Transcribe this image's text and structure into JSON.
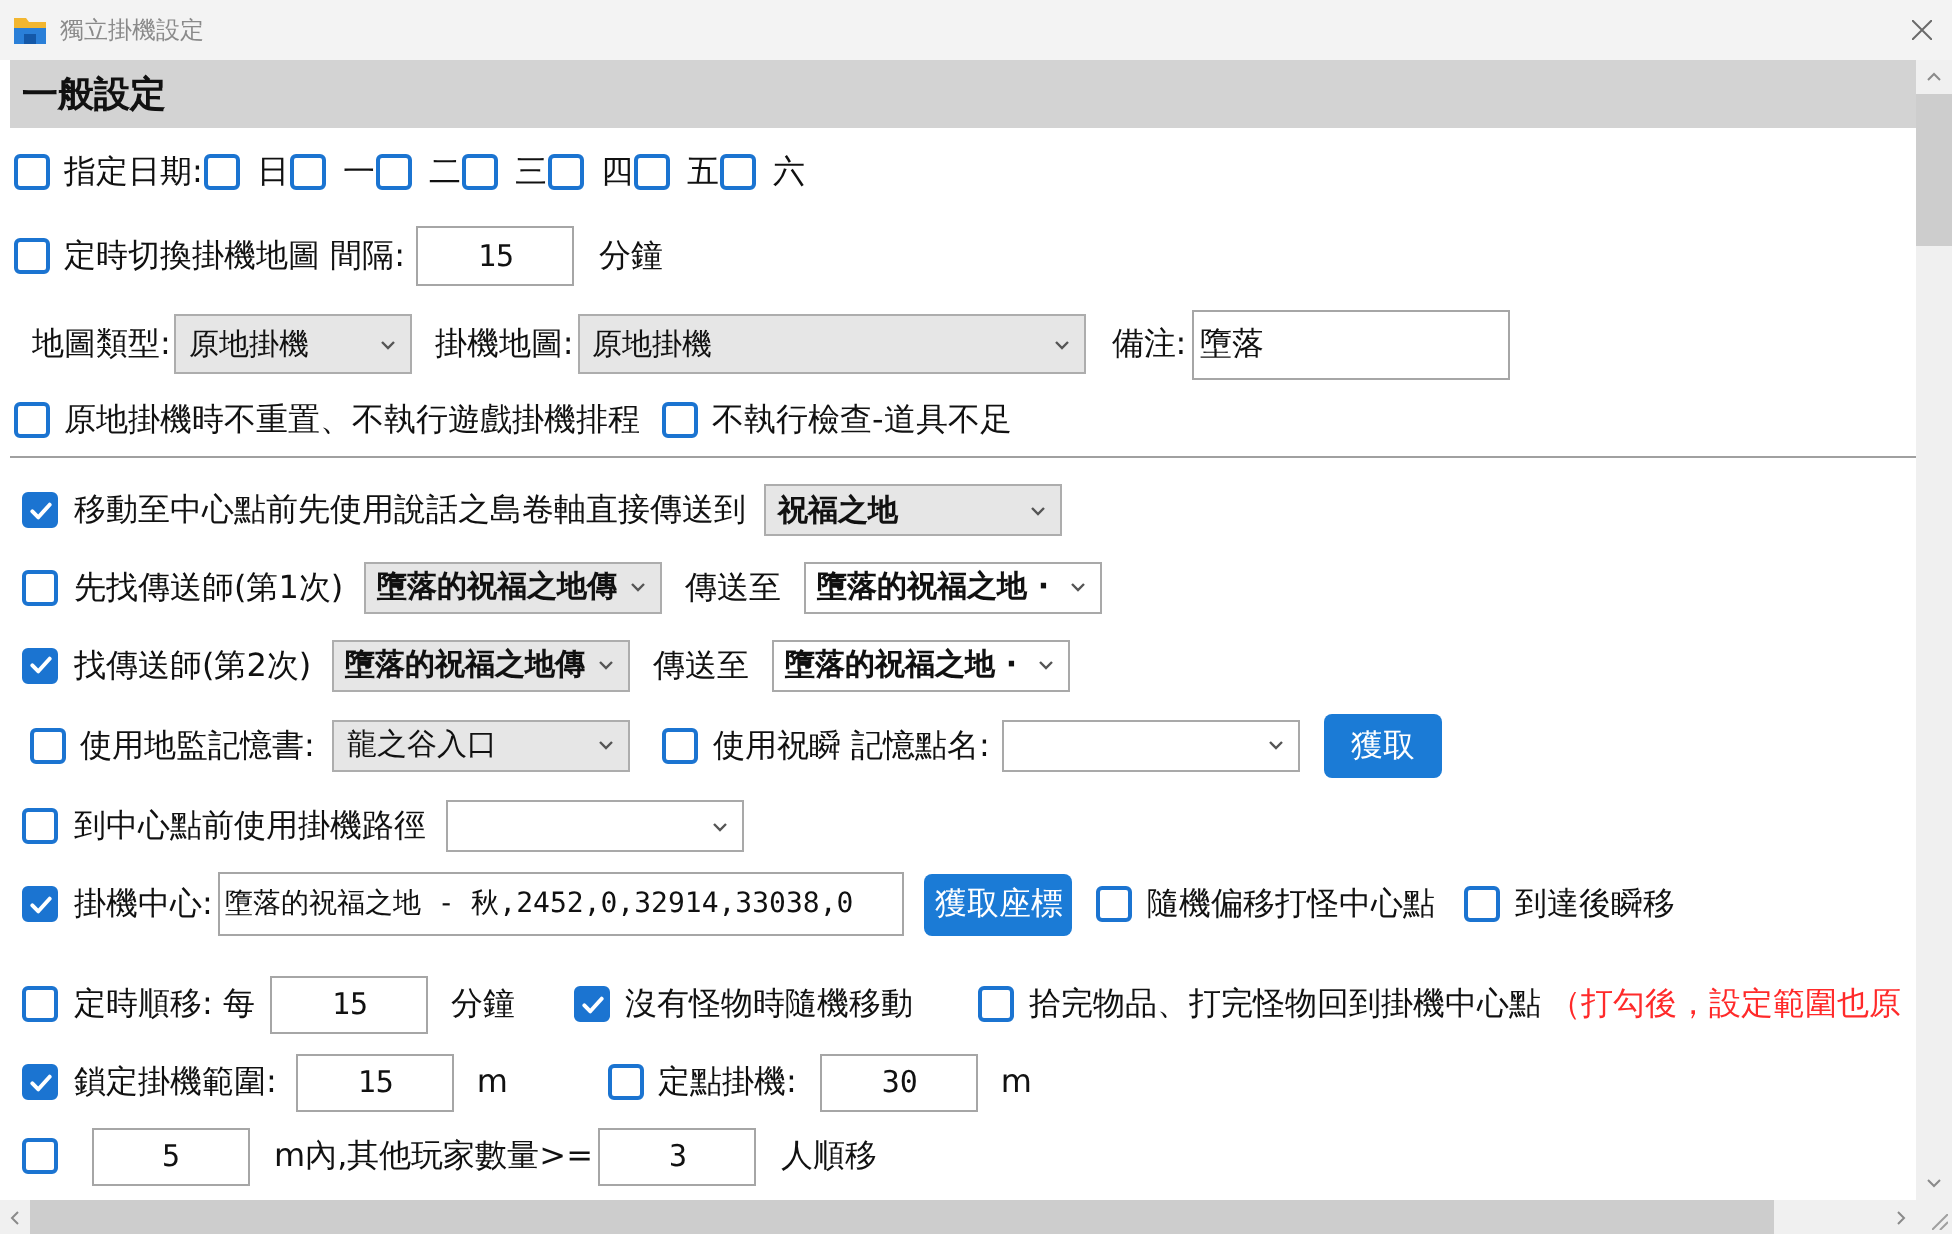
{
  "window": {
    "title": "獨立掛機設定"
  },
  "section": {
    "title": "一般設定"
  },
  "schedule": {
    "label": "指定日期:",
    "checked": false,
    "days": [
      {
        "label": "日",
        "checked": false
      },
      {
        "label": "一",
        "checked": false
      },
      {
        "label": "二",
        "checked": false
      },
      {
        "label": "三",
        "checked": false
      },
      {
        "label": "四",
        "checked": false
      },
      {
        "label": "五",
        "checked": false
      },
      {
        "label": "六",
        "checked": false
      }
    ]
  },
  "map_switch": {
    "label": "定時切換掛機地圖 間隔:",
    "checked": false,
    "value": "15",
    "unit": "分鐘"
  },
  "map_settings": {
    "map_type": {
      "label": "地圖類型:",
      "dropdown": {
        "value": "原地掛機",
        "editable": false
      }
    },
    "idle_map": {
      "label": "掛機地圖:",
      "dropdown": {
        "value": "原地掛機",
        "editable": false
      }
    },
    "note": {
      "label": "備注:",
      "value": "墮落"
    }
  },
  "idle_options": [
    {
      "label": "原地掛機時不重置、不執行遊戲掛機排程",
      "checked": false
    },
    {
      "label": "不執行檢查-道具不足",
      "checked": false
    }
  ],
  "scroll_teleport": {
    "label": "移動至中心點前先使用說話之島卷軸直接傳送到",
    "checked": true,
    "dropdown": {
      "value": "祝福之地",
      "editable": false
    }
  },
  "teleporters": [
    {
      "label": "先找傳送師(第1次)",
      "checked": false,
      "npc": {
        "value": "墮落的祝福之地傳",
        "editable": false
      },
      "to_label": "傳送至",
      "destination": {
        "value": "墮落的祝福之地 ·",
        "editable": true
      }
    },
    {
      "label": "找傳送師(第2次)",
      "checked": true,
      "npc": {
        "value": "墮落的祝福之地傳",
        "editable": false
      },
      "to_label": "傳送至",
      "destination": {
        "value": "墮落的祝福之地 ·",
        "editable": true
      }
    }
  ],
  "memory": {
    "book": {
      "label": "使用地監記憶書:",
      "checked": false,
      "dropdown": {
        "value": "龍之谷入口",
        "editable": false
      }
    },
    "blessed": {
      "label": "使用祝瞬 記憶點名:",
      "checked": false,
      "dropdown": {
        "editable": true
      }
    },
    "button": "獲取"
  },
  "route": {
    "label": "到中心點前使用掛機路徑",
    "checked": false,
    "dropdown": {
      "editable": true
    }
  },
  "center": {
    "label": "掛機中心:",
    "checked": true,
    "value": "墮落的祝福之地 - 秋,2452,0,32914,33038,0",
    "button": "獲取座標",
    "options": [
      {
        "label": "隨機偏移打怪中心點",
        "checked": false
      },
      {
        "label": "到達後瞬移",
        "checked": false
      }
    ]
  },
  "movement": {
    "timed": {
      "label": "定時順移: 每",
      "checked": false,
      "value": "15",
      "unit": "分鐘"
    },
    "random": {
      "label": "沒有怪物時隨機移動",
      "checked": true
    },
    "return": {
      "label": "拾完物品、打完怪物回到掛機中心點",
      "checked": false,
      "warning": "（打勾後，設定範圍也原"
    }
  },
  "range": {
    "lock": {
      "label": "鎖定掛機範圍:",
      "checked": true,
      "value": "15",
      "unit": "m"
    },
    "fixed": {
      "label": "定點掛機:",
      "checked": false,
      "value": "30",
      "unit": "m"
    }
  },
  "crowd": {
    "checked": false,
    "distance": "5",
    "label": "m內,其他玩家數量>=",
    "count": "3",
    "unit": "人順移"
  }
}
